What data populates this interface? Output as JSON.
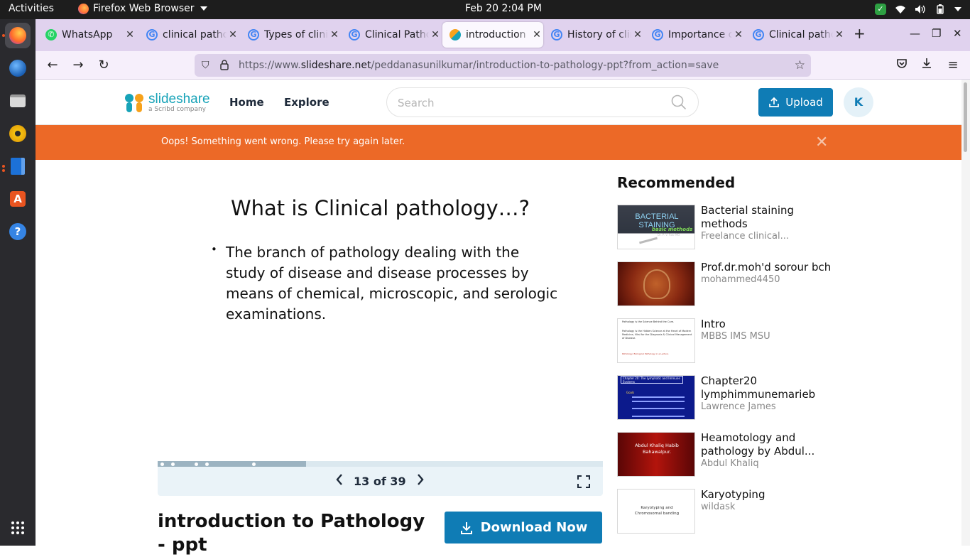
{
  "topbar": {
    "activities": "Activities",
    "app_name": "Firefox Web Browser",
    "clock": "Feb 20  2:04 PM"
  },
  "dock": {
    "items": [
      "firefox",
      "thunderbird",
      "files",
      "rhythmbox",
      "libreoffice-writer",
      "app-center",
      "help"
    ]
  },
  "tabs": [
    {
      "title": "WhatsApp",
      "favicon": "whatsapp-icon"
    },
    {
      "title": "clinical patho",
      "favicon": "google-icon"
    },
    {
      "title": "Types of clini",
      "favicon": "google-icon"
    },
    {
      "title": "Clinical Patho",
      "favicon": "google-icon"
    },
    {
      "title": "introduction",
      "favicon": "slideshare-icon"
    },
    {
      "title": "History of clin",
      "favicon": "google-icon"
    },
    {
      "title": "Importance c",
      "favicon": "google-icon"
    },
    {
      "title": "Clinical patho",
      "favicon": "google-icon"
    }
  ],
  "active_tab_index": 4,
  "url": {
    "scheme": "https://www.",
    "host": "slideshare.net",
    "path": "/peddanasunilkumar/introduction-to-pathology-ppt?from_action=save"
  },
  "site": {
    "logo_name": "slideshare",
    "logo_sub": "a Scribd company",
    "nav": [
      "Home",
      "Explore"
    ],
    "search_placeholder": "Search",
    "upload_label": "Upload",
    "avatar_initial": "K",
    "accent": "#0f7cb5",
    "banner_color": "#ec6927"
  },
  "banner": {
    "message": "Oops! Something went wrong. Please try again later."
  },
  "slide": {
    "title": "What is Clinical pathology…?",
    "bullet": "The branch of pathology dealing with the study of disease and disease processes by means of chemical, microscopic, and serologic examinations.",
    "current": 13,
    "total": 39,
    "counter_text": "13 of 39",
    "progress_fraction": 0.333
  },
  "document": {
    "title": "introduction to Pathology - ppt",
    "download_label": "Download Now"
  },
  "recommended": {
    "heading": "Recommended",
    "items": [
      {
        "title": "Bacterial staining methods",
        "author": "Freelance clinical..."
      },
      {
        "title": "Prof.dr.moh'd sorour bch",
        "author": "mohammed4450"
      },
      {
        "title": "Intro",
        "author": "MBBS IMS MSU"
      },
      {
        "title": "Chapter20 lymphimmunemarieb",
        "author": "Lawrence James"
      },
      {
        "title": "Heamotology and pathology by Abdul...",
        "author": "Abdul Khaliq"
      },
      {
        "title": "Karyotyping",
        "author": "wildask"
      }
    ]
  },
  "thumbs": {
    "bacterial": {
      "line1": "BACTERIAL",
      "line2": "STAINING",
      "line3": "basic methods",
      "line4": "Dr. P. V. Rao MD"
    },
    "intro": {
      "line1": "Pathology is the Science Behind the Cure.",
      "line2": "Pathology is the Hidden Science at the Heart of Modern Medicine, Vital for the Diagnosis & Clinical Management of Disease.",
      "line3": "Pathology: Biological Pathology in a Lecture"
    },
    "chapter20": {
      "line1": "Chapter 20: The Lymphatic and Immune Systems",
      "line2": "Goals"
    },
    "heamotology": {
      "line1": "Abdul Khaliq Habib",
      "line2": "Bahawalpur."
    },
    "karyotyping": {
      "line1": "Karyotyping and",
      "line2": "Chromosomal banding"
    }
  }
}
